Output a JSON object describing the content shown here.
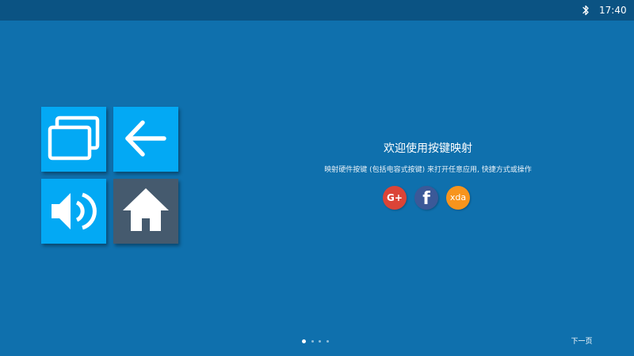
{
  "status_bar": {
    "time": "17:40",
    "bluetooth_icon": "bluetooth-icon"
  },
  "tiles": [
    {
      "icon": "recents-icon",
      "color": "#03a9f4"
    },
    {
      "icon": "back-arrow-icon",
      "color": "#03a9f4"
    },
    {
      "icon": "volume-icon",
      "color": "#03a9f4"
    },
    {
      "icon": "home-icon",
      "color": "#455a6e"
    }
  ],
  "welcome": {
    "title": "欢迎使用按键映射",
    "subtitle": "映射硬件按键 (包括电容式按键) 来打开任意应用, 快捷方式或操作"
  },
  "social": {
    "google_label": "G+",
    "facebook_label": "f",
    "xda_label": "xda",
    "google_color": "#db4437",
    "facebook_color": "#3b5998",
    "xda_color": "#f7941d"
  },
  "pager": {
    "active_page": 1,
    "page_count": 4
  },
  "next_button": {
    "label": "下一页"
  },
  "colors": {
    "background": "#0f70ad",
    "status_bar": "#0b5383"
  }
}
